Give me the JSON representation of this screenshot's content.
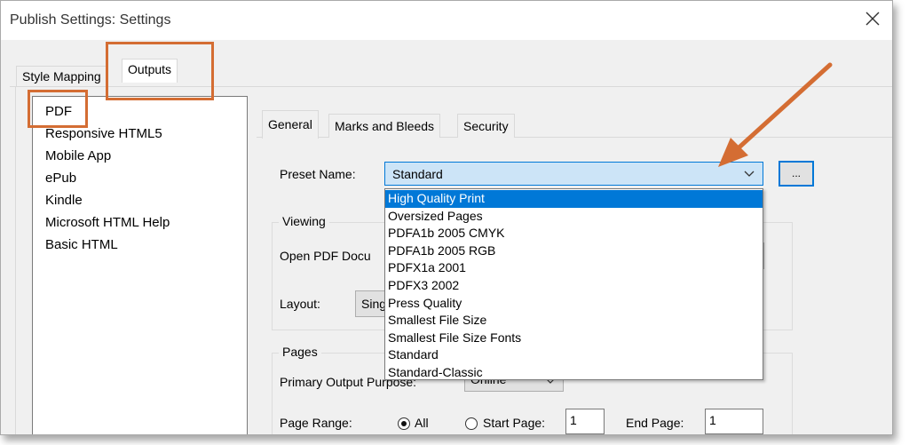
{
  "window": {
    "title": "Publish Settings: Settings"
  },
  "outer_tabs": [
    {
      "label": "Style Mapping"
    },
    {
      "label": "Outputs"
    }
  ],
  "outputs_list": [
    {
      "label": "PDF"
    },
    {
      "label": "Responsive HTML5"
    },
    {
      "label": "Mobile App"
    },
    {
      "label": "ePub"
    },
    {
      "label": "Kindle"
    },
    {
      "label": "Microsoft HTML Help"
    },
    {
      "label": "Basic HTML"
    }
  ],
  "inner_tabs": [
    {
      "label": "General"
    },
    {
      "label": "Marks and Bleeds"
    },
    {
      "label": "Security"
    }
  ],
  "preset": {
    "label": "Preset Name:",
    "value": "Standard",
    "button_label": "...",
    "options": [
      "High Quality Print",
      "Oversized Pages",
      "PDFA1b 2005 CMYK",
      "PDFA1b 2005 RGB",
      "PDFX1a 2001",
      "PDFX3 2002",
      "Press Quality",
      "Smallest File Size",
      "Smallest File Size Fonts",
      "Standard",
      "Standard-Classic"
    ],
    "highlighted_option": "High Quality Print"
  },
  "viewing": {
    "group_label": "Viewing",
    "open_label": "Open PDF Docu",
    "layout_label": "Layout:",
    "layout_value": "Sing"
  },
  "pages": {
    "group_label": "Pages",
    "purpose_label": "Primary Output Purpose:",
    "purpose_value": "Online",
    "range_label": "Page Range:",
    "all_label": "All",
    "start_label": "Start Page:",
    "start_value": "1",
    "end_label": "End Page:",
    "end_value": "1"
  },
  "colors": {
    "annotation": "#d46d33",
    "selection": "#0078d7",
    "combo_bg": "#cce4f7"
  }
}
